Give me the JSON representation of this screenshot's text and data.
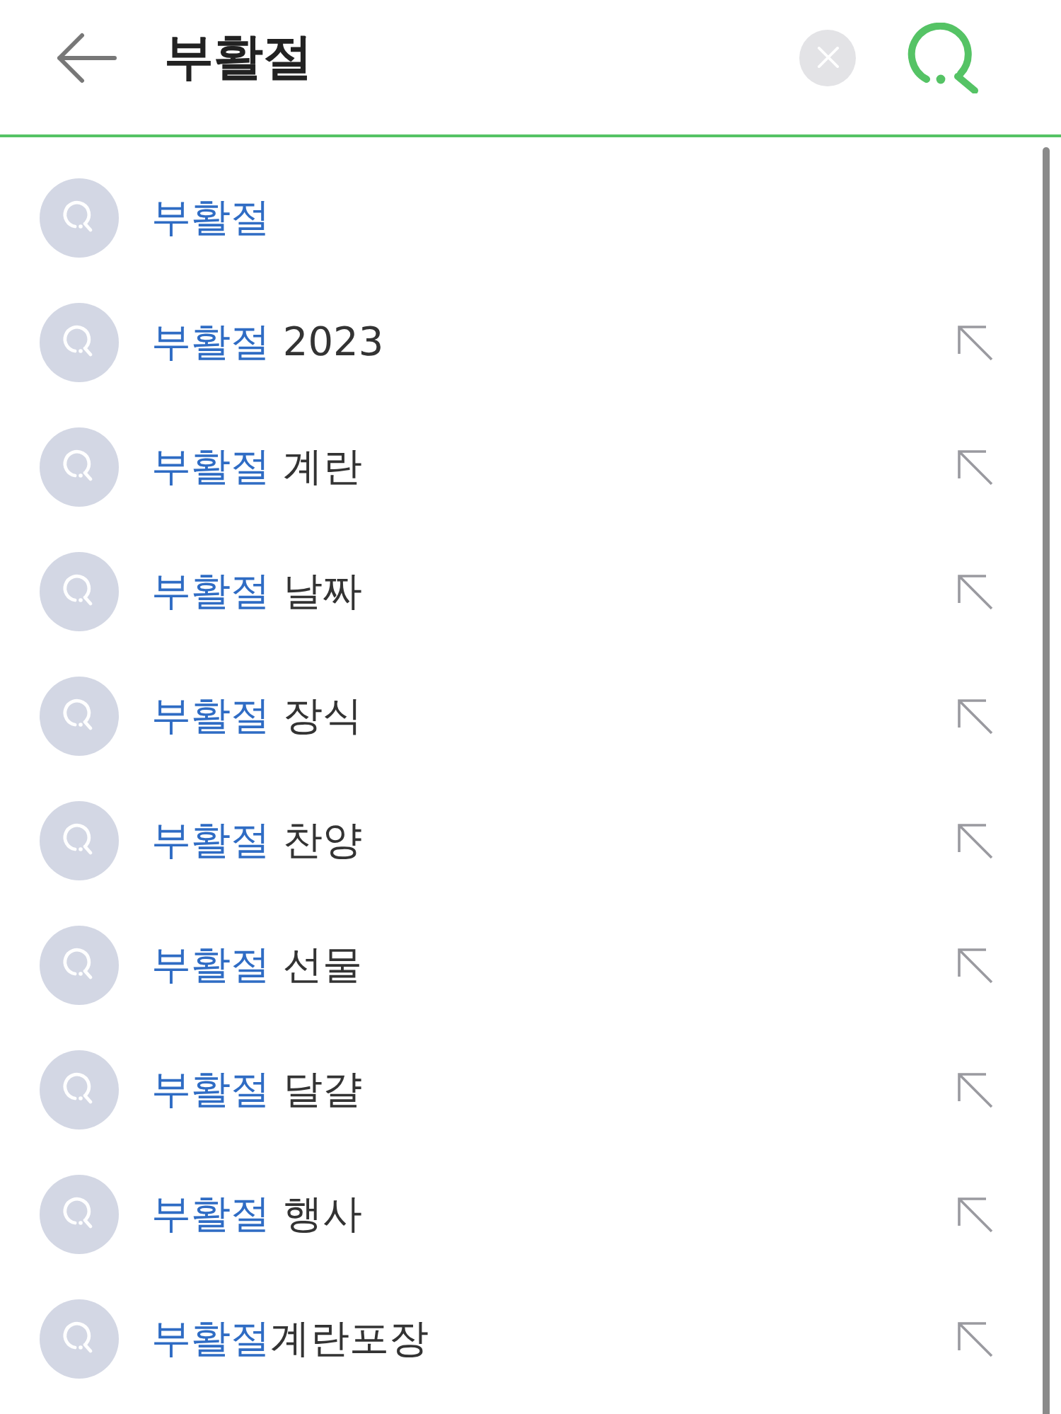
{
  "search": {
    "value": "부활절"
  },
  "suggestions": [
    {
      "match": "부활절",
      "insert_arrow": false
    },
    {
      "match": "부활절",
      "rest": " 2023",
      "insert_arrow": true
    },
    {
      "match": "부활절",
      "rest": " 계란",
      "insert_arrow": true
    },
    {
      "match": "부활절",
      "rest": " 날짜",
      "insert_arrow": true
    },
    {
      "match": "부활절",
      "rest": " 장식",
      "insert_arrow": true
    },
    {
      "match": "부활절",
      "rest": " 찬양",
      "insert_arrow": true
    },
    {
      "match": "부활절",
      "rest": " 선물",
      "insert_arrow": true
    },
    {
      "match": "부활절",
      "rest": " 달걀",
      "insert_arrow": true
    },
    {
      "match": "부활절",
      "rest": " 행사",
      "insert_arrow": true
    },
    {
      "match": "부활절",
      "rest": "계란포장",
      "insert_arrow": true
    }
  ]
}
